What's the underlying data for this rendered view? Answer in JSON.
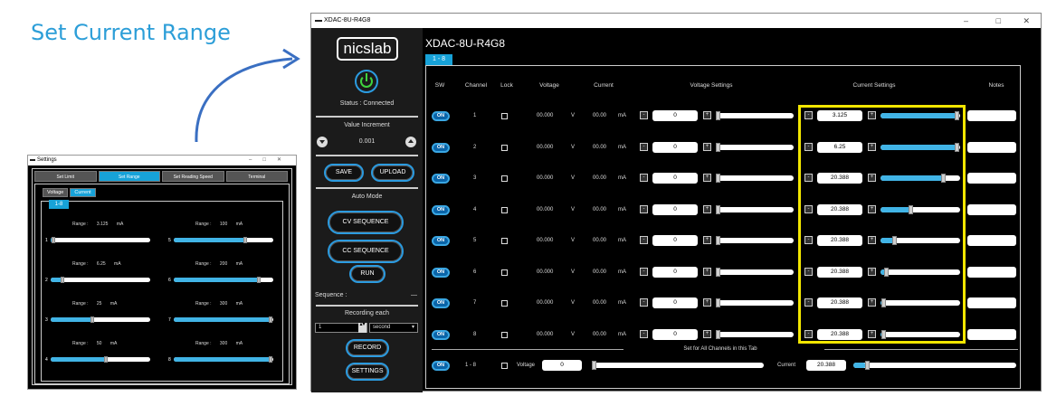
{
  "heading": "Set Current Range",
  "settings_window": {
    "title": "Settings",
    "tabs": [
      "Set Limit",
      "Set Range",
      "Set Reading Speed",
      "Terminal"
    ],
    "active_tab": 1,
    "subtabs": [
      "Voltage",
      "Current"
    ],
    "active_subtab": 1,
    "channel_tab": "1-8",
    "range_label": "Range :",
    "unit": "mA",
    "channels": [
      {
        "num": "1",
        "range": "3.125",
        "level": 0.03
      },
      {
        "num": "2",
        "range": "6.25",
        "level": 0.12
      },
      {
        "num": "3",
        "range": "25",
        "level": 0.42
      },
      {
        "num": "4",
        "range": "50",
        "level": 0.55
      },
      {
        "num": "5",
        "range": "100",
        "level": 0.72
      },
      {
        "num": "6",
        "range": "200",
        "level": 0.85
      },
      {
        "num": "7",
        "range": "300",
        "level": 0.97
      },
      {
        "num": "8",
        "range": "300",
        "level": 0.97
      }
    ]
  },
  "main_window": {
    "title": "XDAC-8U-R4G8",
    "app_title": "XDAC-8U-R4G8",
    "logo": "nicslab",
    "status": "Status : Connected",
    "value_increment_label": "Value Increment",
    "increment_value": "0.001",
    "save_label": "SAVE",
    "upload_label": "UPLOAD",
    "auto_mode_label": "Auto Mode",
    "cv_label": "CV SEQUENCE",
    "cc_label": "CC SEQUENCE",
    "run_label": "RUN",
    "sequence_label": "Sequence :",
    "sequence_value": "—",
    "recording_label": "Recording each",
    "recording_value": "1",
    "recording_unit": "second",
    "record_label": "RECORD",
    "settings_label": "SETTINGS",
    "tab_label": "1 - 8",
    "headers": {
      "sw": "SW",
      "channel": "Channel",
      "lock": "Lock",
      "voltage": "Voltage",
      "current": "Current",
      "voltage_settings": "Voltage Settings",
      "current_settings": "Current Settings",
      "notes": "Notes"
    },
    "on_label": "ON",
    "voltage_unit": "V",
    "current_unit": "mA",
    "minus": "-",
    "plus": "+",
    "rows": [
      {
        "channel": "1",
        "voltage": "00.000",
        "current": "00.00",
        "vset": "0",
        "iset": "3.125",
        "ilevel": 0.99
      },
      {
        "channel": "2",
        "voltage": "00.000",
        "current": "00.00",
        "vset": "0",
        "iset": "6.25",
        "ilevel": 0.99
      },
      {
        "channel": "3",
        "voltage": "00.000",
        "current": "00.00",
        "vset": "0",
        "iset": "20.388",
        "ilevel": 0.82
      },
      {
        "channel": "4",
        "voltage": "00.000",
        "current": "00.00",
        "vset": "0",
        "iset": "20.388",
        "ilevel": 0.41
      },
      {
        "channel": "5",
        "voltage": "00.000",
        "current": "00.00",
        "vset": "0",
        "iset": "20.388",
        "ilevel": 0.2
      },
      {
        "channel": "6",
        "voltage": "00.000",
        "current": "00.00",
        "vset": "0",
        "iset": "20.388",
        "ilevel": 0.1
      },
      {
        "channel": "7",
        "voltage": "00.000",
        "current": "00.00",
        "vset": "0",
        "iset": "20.388",
        "ilevel": 0.07
      },
      {
        "channel": "8",
        "voltage": "00.000",
        "current": "00.00",
        "vset": "0",
        "iset": "20.388",
        "ilevel": 0.07
      }
    ],
    "footer": {
      "label": "Set for All Channels in this Tab",
      "channels": "1 - 8",
      "voltage_label": "Voltage",
      "voltage_value": "0",
      "current_label": "Current",
      "current_value": "20.388"
    }
  }
}
